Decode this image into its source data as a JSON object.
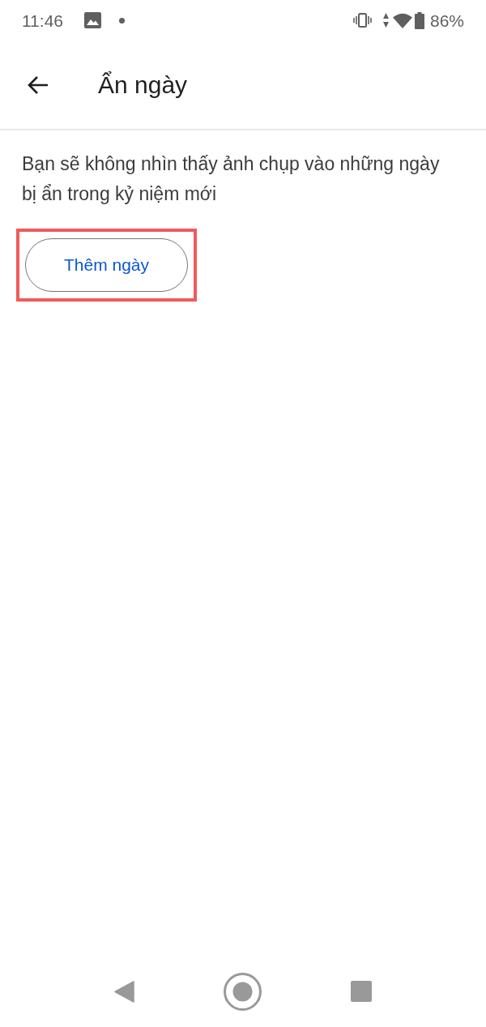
{
  "status_bar": {
    "time": "11:46",
    "battery": "86%"
  },
  "app_bar": {
    "title": "Ẩn ngày"
  },
  "content": {
    "description": "Bạn sẽ không nhìn thấy ảnh chụp vào những ngày bị ẩn trong kỷ niệm mới",
    "add_button": {
      "label": "Thêm ngày",
      "highlighted": true
    }
  }
}
